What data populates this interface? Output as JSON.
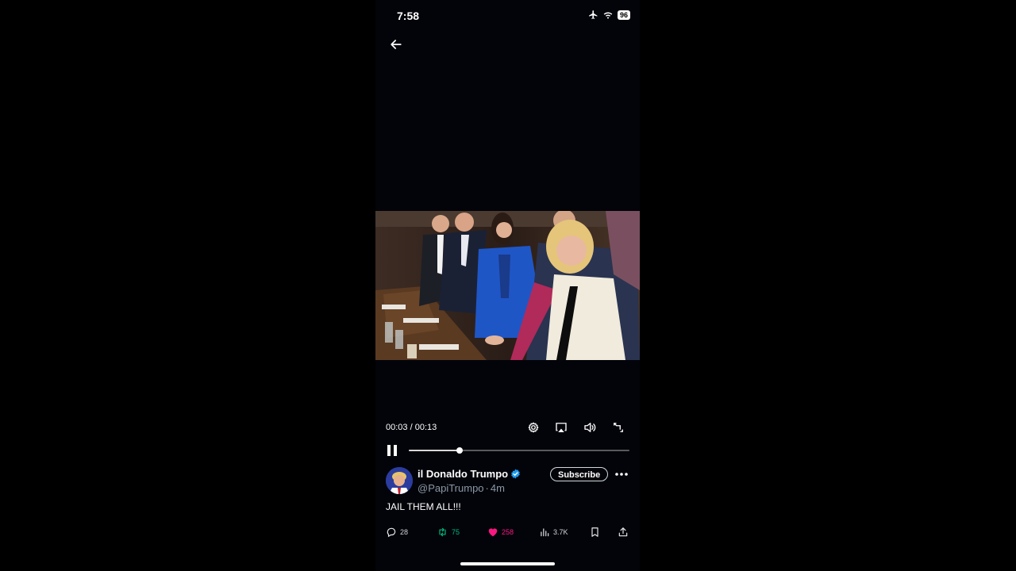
{
  "status_bar": {
    "time": "7:58",
    "battery": "96"
  },
  "player": {
    "current_time": "00:03",
    "duration": "00:13",
    "time_separator": " / ",
    "progress_fraction": 0.23
  },
  "post": {
    "display_name": "il Donaldo Trumpo",
    "handle": "@PapiTrumpo",
    "separator": "·",
    "age": "4m",
    "subscribe_label": "Subscribe",
    "text": "JAIL THEM ALL!!!"
  },
  "actions": {
    "replies": "28",
    "reposts": "75",
    "likes": "258",
    "views": "3.7K"
  },
  "colors": {
    "background": "#03040a",
    "verified": "#1d9bf0",
    "repost": "#00ba7c",
    "like": "#f91880",
    "muted": "#8b98a5"
  },
  "icons": [
    "back-arrow-icon",
    "airplane-icon",
    "wifi-icon",
    "battery-icon",
    "settings-icon",
    "airplay-icon",
    "volume-icon",
    "fullscreen-icon",
    "pause-icon",
    "verified-icon",
    "more-icon",
    "reply-icon",
    "repost-icon",
    "like-icon",
    "views-icon",
    "bookmark-icon",
    "share-icon"
  ]
}
